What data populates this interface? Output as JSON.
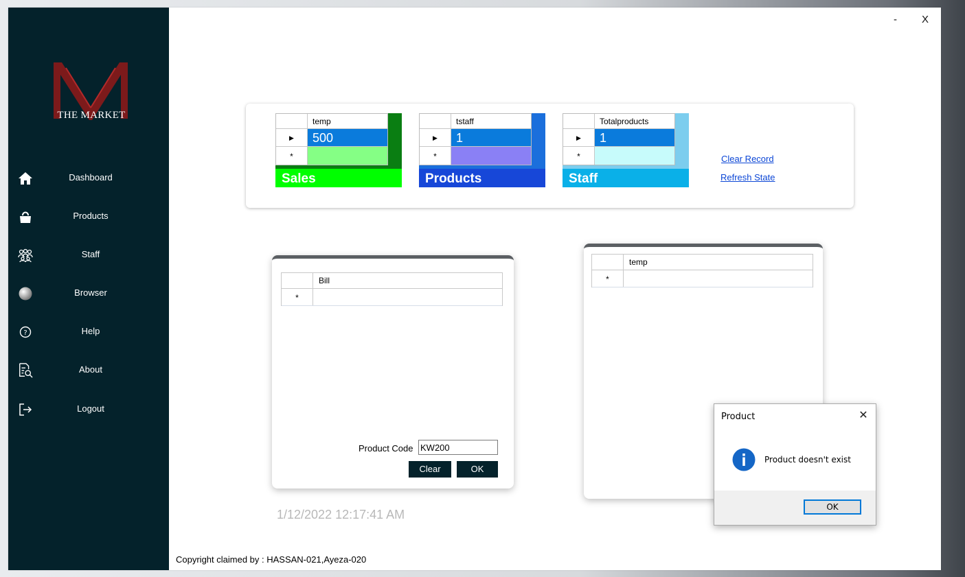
{
  "brand": {
    "logo_letter": "M",
    "logo_text": "THE MARKET"
  },
  "window_controls": {
    "minimize": "-",
    "close": "X"
  },
  "sidebar": {
    "items": [
      {
        "label": "Dashboard",
        "icon": "home-icon"
      },
      {
        "label": "Products",
        "icon": "bag-icon"
      },
      {
        "label": "Staff",
        "icon": "people-icon"
      },
      {
        "label": "Browser",
        "icon": "globe-icon"
      },
      {
        "label": "Help",
        "icon": "help-icon"
      },
      {
        "label": "About",
        "icon": "document-search-icon"
      },
      {
        "label": "Logout",
        "icon": "logout-icon"
      }
    ]
  },
  "stats": [
    {
      "column": "temp",
      "value": "500",
      "label": "Sales",
      "colors": {
        "bar": "#0a7e12",
        "label_bg": "#00ff00",
        "selected": "#0a7bdc",
        "new_row": "#85ff85"
      }
    },
    {
      "column": "tstaff",
      "value": "1",
      "label": "Products",
      "colors": {
        "bar": "#1b6fdc",
        "label_bg": "#1747d8",
        "selected": "#0a7bdc",
        "new_row": "#8a80f5"
      }
    },
    {
      "column": "Totalproducts",
      "value": "1",
      "label": "Staff",
      "colors": {
        "bar": "#7ccdee",
        "label_bg": "#0ab0e8",
        "selected": "#0a7bdc",
        "new_row": "#c7fbfb"
      }
    }
  ],
  "links": {
    "clear_record": "Clear Record",
    "refresh_state": "Refresh State"
  },
  "bill_panel": {
    "column": "Bill",
    "product_code_label": "Product Code",
    "product_code_value": "KW200",
    "clear_button": "Clear",
    "ok_button": "OK"
  },
  "temp_panel": {
    "column": "temp"
  },
  "glyphs": {
    "current_row": "▶",
    "new_row": "*"
  },
  "timestamp": "1/12/2022 12:17:41 AM",
  "copyright": "Copyright claimed by : HASSAN-021,Ayeza-020",
  "dialog": {
    "title": "Product",
    "close": "✕",
    "message": "Product doesn't exist",
    "ok": "OK",
    "icon": "info-icon"
  }
}
